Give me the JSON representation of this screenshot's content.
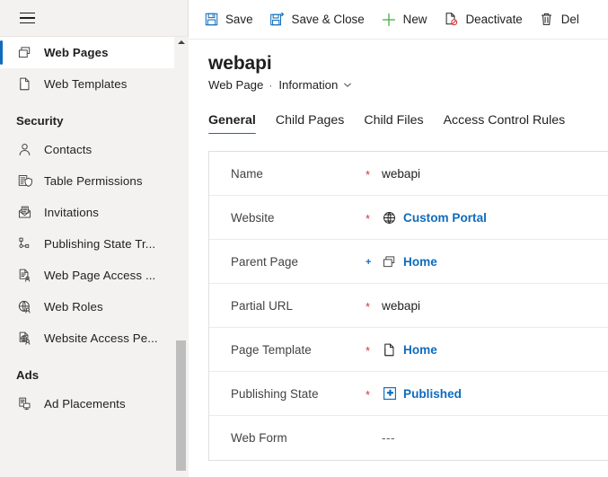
{
  "sidebar": {
    "hamburger_label": "site-map-toggle",
    "items": [
      {
        "type": "item",
        "label": "Web Pages",
        "icon": "web-pages-icon",
        "selected": true
      },
      {
        "type": "item",
        "label": "Web Templates",
        "icon": "web-templates-icon",
        "selected": false
      },
      {
        "type": "group",
        "label": "Security"
      },
      {
        "type": "item",
        "label": "Contacts",
        "icon": "contact-icon",
        "selected": false
      },
      {
        "type": "item",
        "label": "Table  Permissions",
        "icon": "table-permissions-icon",
        "selected": false
      },
      {
        "type": "item",
        "label": "Invitations",
        "icon": "invitations-icon",
        "selected": false
      },
      {
        "type": "item",
        "label": "Publishing State Tr...",
        "icon": "publishing-state-transition-icon",
        "selected": false
      },
      {
        "type": "item",
        "label": "Web Page Access ...",
        "icon": "web-page-access-icon",
        "selected": false
      },
      {
        "type": "item",
        "label": "Web Roles",
        "icon": "web-roles-icon",
        "selected": false
      },
      {
        "type": "item",
        "label": "Website Access Pe...",
        "icon": "website-access-permission-icon",
        "selected": false
      },
      {
        "type": "group",
        "label": "Ads"
      },
      {
        "type": "item",
        "label": "Ad Placements",
        "icon": "ad-placements-icon",
        "selected": false
      }
    ]
  },
  "commandbar": {
    "buttons": [
      {
        "label": "Save",
        "icon": "save-icon"
      },
      {
        "label": "Save & Close",
        "icon": "save-and-close-icon"
      },
      {
        "label": "New",
        "icon": "plus-icon"
      },
      {
        "label": "Deactivate",
        "icon": "deactivate-icon"
      },
      {
        "label": "Del",
        "icon": "delete-icon"
      }
    ]
  },
  "header": {
    "record_title": "webapi",
    "entity_name": "Web Page",
    "separator": "·",
    "form_name": "Information",
    "chevron": "chevron-down-icon"
  },
  "tabs": [
    {
      "label": "General",
      "active": true
    },
    {
      "label": "Child Pages",
      "active": false
    },
    {
      "label": "Child Files",
      "active": false
    },
    {
      "label": "Access Control Rules",
      "active": false
    }
  ],
  "form": {
    "fields": [
      {
        "label": "Name",
        "required": "*",
        "req_kind": "required",
        "value": "webapi",
        "icon": null,
        "link": false
      },
      {
        "label": "Website",
        "required": "*",
        "req_kind": "required",
        "value": "Custom Portal",
        "icon": "globe-icon",
        "link": true
      },
      {
        "label": "Parent Page",
        "required": "+",
        "req_kind": "recommended",
        "value": "Home",
        "icon": "web-pages-icon",
        "link": true
      },
      {
        "label": "Partial URL",
        "required": "*",
        "req_kind": "required",
        "value": "webapi",
        "icon": null,
        "link": false
      },
      {
        "label": "Page Template",
        "required": "*",
        "req_kind": "required",
        "value": "Home",
        "icon": "page-template-icon",
        "link": true
      },
      {
        "label": "Publishing State",
        "required": "*",
        "req_kind": "required",
        "value": "Published",
        "icon": "publishing-state-icon",
        "link": true
      },
      {
        "label": "Web Form",
        "required": "",
        "req_kind": "none",
        "value": "---",
        "icon": null,
        "link": false
      }
    ]
  },
  "colors": {
    "accent": "#0f6cbd",
    "required": "#d13438",
    "sidebar_bg": "#f3f2f1",
    "text": "#201f1e",
    "new_green": "#5cb85c"
  }
}
